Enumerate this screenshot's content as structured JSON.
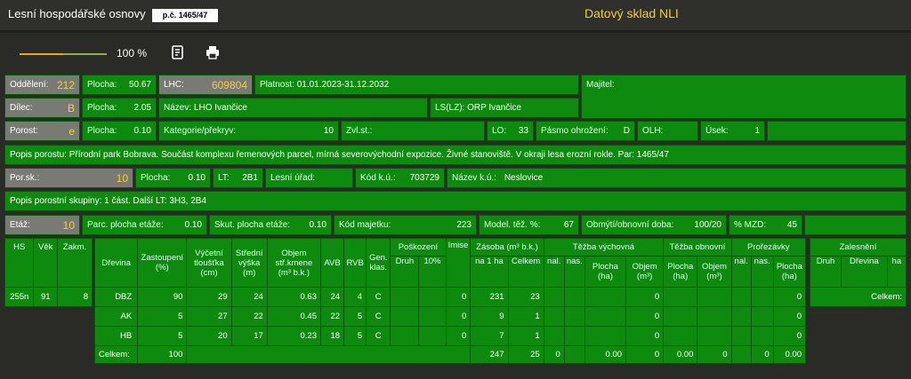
{
  "header": {
    "app_title": "Lesní hospodářské osnovy",
    "parcel_badge": "p.č. 1465/47",
    "source_title": "Datový sklad NLI"
  },
  "toolbar": {
    "zoom_value": 0.5,
    "zoom_label": "100 %",
    "notes_icon": "notes-icon",
    "print_icon": "print-icon"
  },
  "info": {
    "oddeleni_label": "Oddělení:",
    "oddeleni": "212",
    "plocha1_label": "Plocha:",
    "plocha1": "50.67",
    "lhc_label": "LHC:",
    "lhc": "609804",
    "platnost_label": "Platnost:",
    "platnost": "01.01.2023-31.12.2032",
    "majitel_label": "Majitel:",
    "dilec_label": "Dílec:",
    "dilec": "B",
    "plocha2_label": "Plocha:",
    "plocha2": "2.05",
    "nazev_label": "Název:",
    "nazev": "LHO Ivančice",
    "lslz_label": "LS(LZ):",
    "lslz": "ORP Ivančice",
    "porost_label": "Porost:",
    "porost": "e",
    "plocha3_label": "Plocha:",
    "plocha3": "0.10",
    "kategorie_label": "Kategorie/překryv:",
    "kategorie": "10",
    "zvlst_label": "Zvl.st.:",
    "lo_label": "LO:",
    "lo": "33",
    "pasmo_label": "Pásmo ohrožení:",
    "pasmo": "D",
    "olh_label": "OLH:",
    "usek_label": "Úsek:",
    "usek": "1",
    "popis_porostu": "Popis porostu: Přírodní park Bobrava. Součást komplexu řemenových parcel, mírná severovýchodní expozice. Živné stanoviště. V okraji lesa erozní rokle. Par: 1465/47",
    "porsk_label": "Por.sk.:",
    "porsk": "10",
    "plocha4_label": "Plocha:",
    "plocha4": "0.10",
    "lt_label": "LT:",
    "lt": "2B1",
    "lesni_urad_label": "Lesní úřad:",
    "kodku_label": "Kód k.ú.:",
    "kodku": "703729",
    "nazevku_label": "Název k.ú.:",
    "nazevku": "Neslovice",
    "popis_skupiny": "Popis porostní skupiny: 1 část. Další LT: 3H3, 2B4",
    "etaz_label": "Etáž:",
    "etaz": "10",
    "parc_plocha_label": "Parc. plocha etáže:",
    "parc_plocha": "0.10",
    "skut_plocha_label": "Skut. plocha etáže:",
    "skut_plocha": "0.10",
    "kod_majetku_label": "Kód majetku:",
    "kod_majetku": "223",
    "model_tez_label": "Model. těž. %:",
    "model_tez": "67",
    "obmyti_label": "Obmýtí/obnovní doba:",
    "obmyti": "100/20",
    "mzd_label": "% MZD:",
    "mzd": "45"
  },
  "left_table": {
    "headers": [
      "HS",
      "Věk",
      "Zakm."
    ],
    "row": [
      "255n",
      "91",
      "8"
    ]
  },
  "main_table": {
    "h": {
      "drevina": "Dřevina",
      "zastoupeni": "Zastoupení (%)",
      "vycetni": "Výčetní tloušťka (cm)",
      "stredni": "Střední výška (m)",
      "objem": "Objem stř.kmene (m³ b.k.)",
      "avb": "AVB",
      "rvb": "RVB",
      "gen": "Gen. klas.",
      "poskozeni": "Poškození",
      "druh": "Druh",
      "pct10": "10%",
      "imise": "Imise",
      "zasoba": "Zásoba (m³ b.k.)",
      "na1ha": "na 1 ha",
      "celkem": "Celkem",
      "tezba_vych": "Těžba výchovná",
      "tezba_obn": "Těžba obnovní",
      "prorezavky": "Prořezávky",
      "nal": "nal.",
      "nas": "nas.",
      "plocha_ha": "Plocha (ha)",
      "objem_m3": "Objem (m³)"
    },
    "rows": [
      [
        "DBZ",
        "90",
        "29",
        "24",
        "0.63",
        "24",
        "4",
        "C",
        "",
        "",
        "0",
        "231",
        "23",
        "",
        "",
        "",
        "0",
        "",
        "0"
      ],
      [
        "AK",
        "5",
        "27",
        "22",
        "0.45",
        "22",
        "5",
        "C",
        "",
        "",
        "0",
        "9",
        "1",
        "",
        "",
        "",
        "0",
        "",
        "0"
      ],
      [
        "HB",
        "5",
        "20",
        "17",
        "0.23",
        "18",
        "5",
        "C",
        "",
        "",
        "0",
        "7",
        "1",
        "",
        "",
        "",
        "0",
        "",
        "0"
      ]
    ],
    "total": {
      "label": "Celkem:",
      "zastoupeni": "100",
      "na1ha": "247",
      "celkem": "25",
      "tv_nal": "0",
      "tv_plocha": "0.00",
      "tv_objem": "0",
      "to_plocha": "0.00",
      "to_objem": "0",
      "pr_nas": "0",
      "pr_plocha": "0.00"
    }
  },
  "zalesneni": {
    "title": "Zalesnění",
    "druh": "Druh",
    "drevina": "Dřevina",
    "ha": "ha",
    "celkem": "Celkem:"
  }
}
